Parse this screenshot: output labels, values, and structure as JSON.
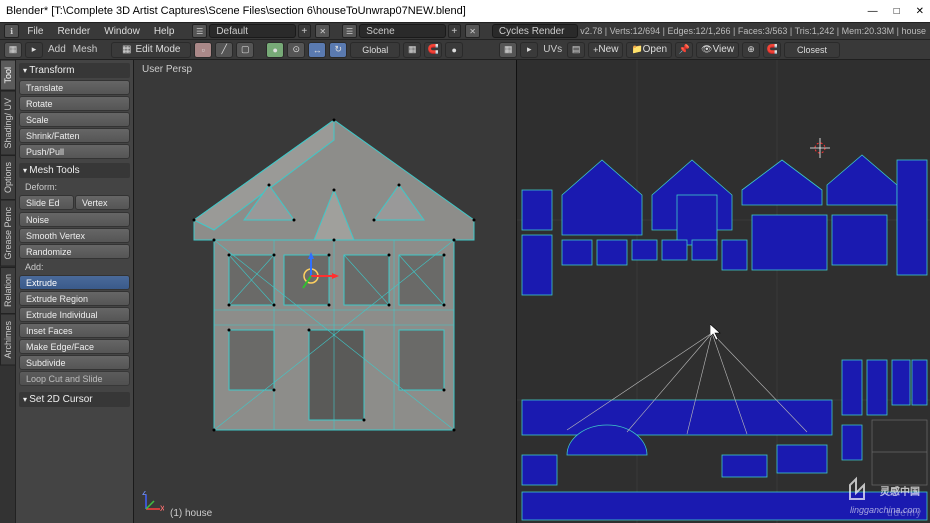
{
  "title": "Blender* [T:\\Complete 3D Artist Captures\\Scene Files\\section 6\\houseToUnwrap07NEW.blend]",
  "topmenu": {
    "items": [
      "File",
      "Render",
      "Window",
      "Help"
    ],
    "layout": "Default",
    "scene_dropdown": "Scene",
    "renderer": "Cycles Render"
  },
  "stats": "v2.78 | Verts:12/694 | Edges:12/1,266 | Faces:3/563 | Tris:1,242 | Mem:20.33M | house",
  "toolbar2": {
    "add": "Add",
    "mesh": "Mesh",
    "mode": "Edit Mode",
    "orient": "Global",
    "uvs": "UVs",
    "new": "New",
    "open": "Open",
    "view": "View",
    "closest": "Closest"
  },
  "sidetabs": [
    "Tool",
    "Shading/ UV",
    "Options",
    "Grease Penc",
    "Relation",
    "Archimes"
  ],
  "panel": {
    "transform": "Transform",
    "transform_btns": [
      "Translate",
      "Rotate",
      "Scale",
      "Shrink/Fatten",
      "Push/Pull"
    ],
    "meshtools": "Mesh Tools",
    "deform": "Deform:",
    "slide": "Slide Ed",
    "vertex": "Vertex",
    "deform_btns": [
      "Noise",
      "Smooth Vertex",
      "Randomize"
    ],
    "add": "Add:",
    "add_btns": [
      "Extrude",
      "Extrude Region",
      "Extrude Individual",
      "Inset Faces",
      "Make Edge/Face",
      "Subdivide",
      "Loop Cut and Slide"
    ],
    "set2d": "Set 2D Cursor"
  },
  "viewport": {
    "persp": "User Persp",
    "bottom": "(1) house"
  },
  "watermark": {
    "main": "灵感中国",
    "sub": "lingganchina.com"
  },
  "udemy": "udemy"
}
